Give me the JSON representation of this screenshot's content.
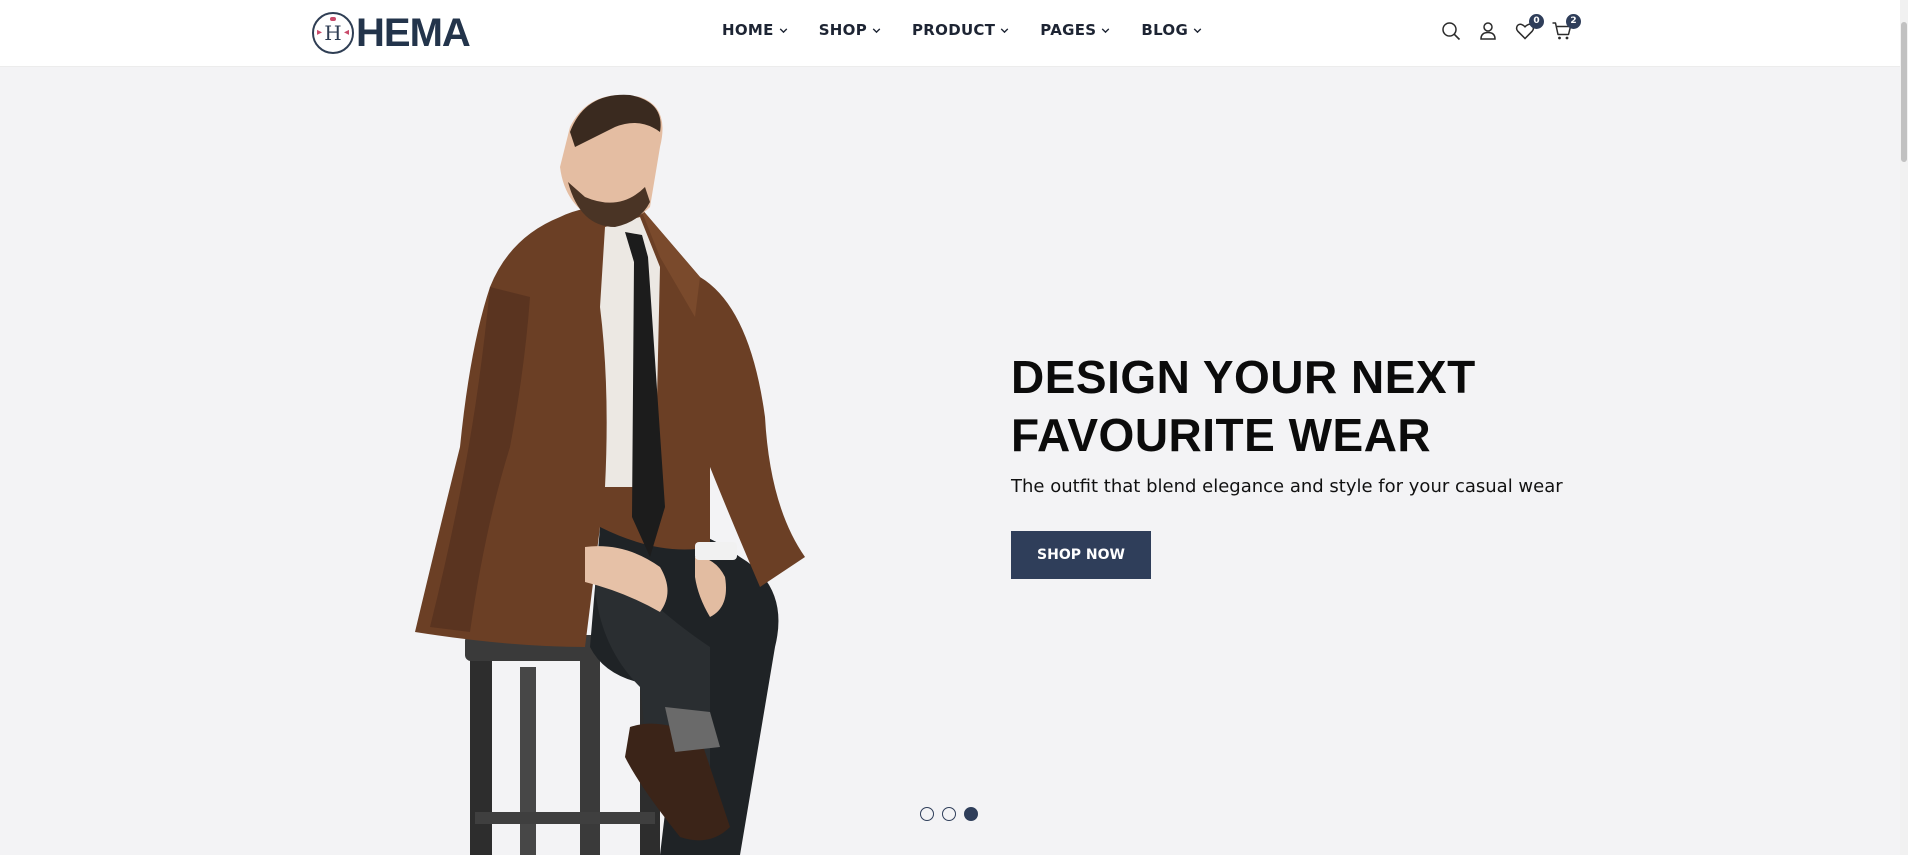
{
  "brand": {
    "name": "HEMA",
    "logo_letter": "H"
  },
  "nav": {
    "items": [
      {
        "label": "HOME"
      },
      {
        "label": "SHOP"
      },
      {
        "label": "PRODUCT"
      },
      {
        "label": "PAGES"
      },
      {
        "label": "BLOG"
      }
    ]
  },
  "header_icons": {
    "search": {
      "icon": "search-icon"
    },
    "account": {
      "icon": "user-icon"
    },
    "wishlist": {
      "icon": "heart-icon",
      "count": "0"
    },
    "cart": {
      "icon": "cart-icon",
      "count": "2"
    }
  },
  "hero": {
    "headline_line1": "DESIGN YOUR NEXT",
    "headline_line2": "FAVOURITE WEAR",
    "subtitle": "The outfit that blend elegance and style for your casual wear",
    "cta_label": "SHOP NOW",
    "slides": 3,
    "active_slide": 3
  },
  "colors": {
    "accent": "#2f3e5a",
    "hero_bg": "#f3f3f5",
    "logo_pink": "#c94a6a"
  }
}
